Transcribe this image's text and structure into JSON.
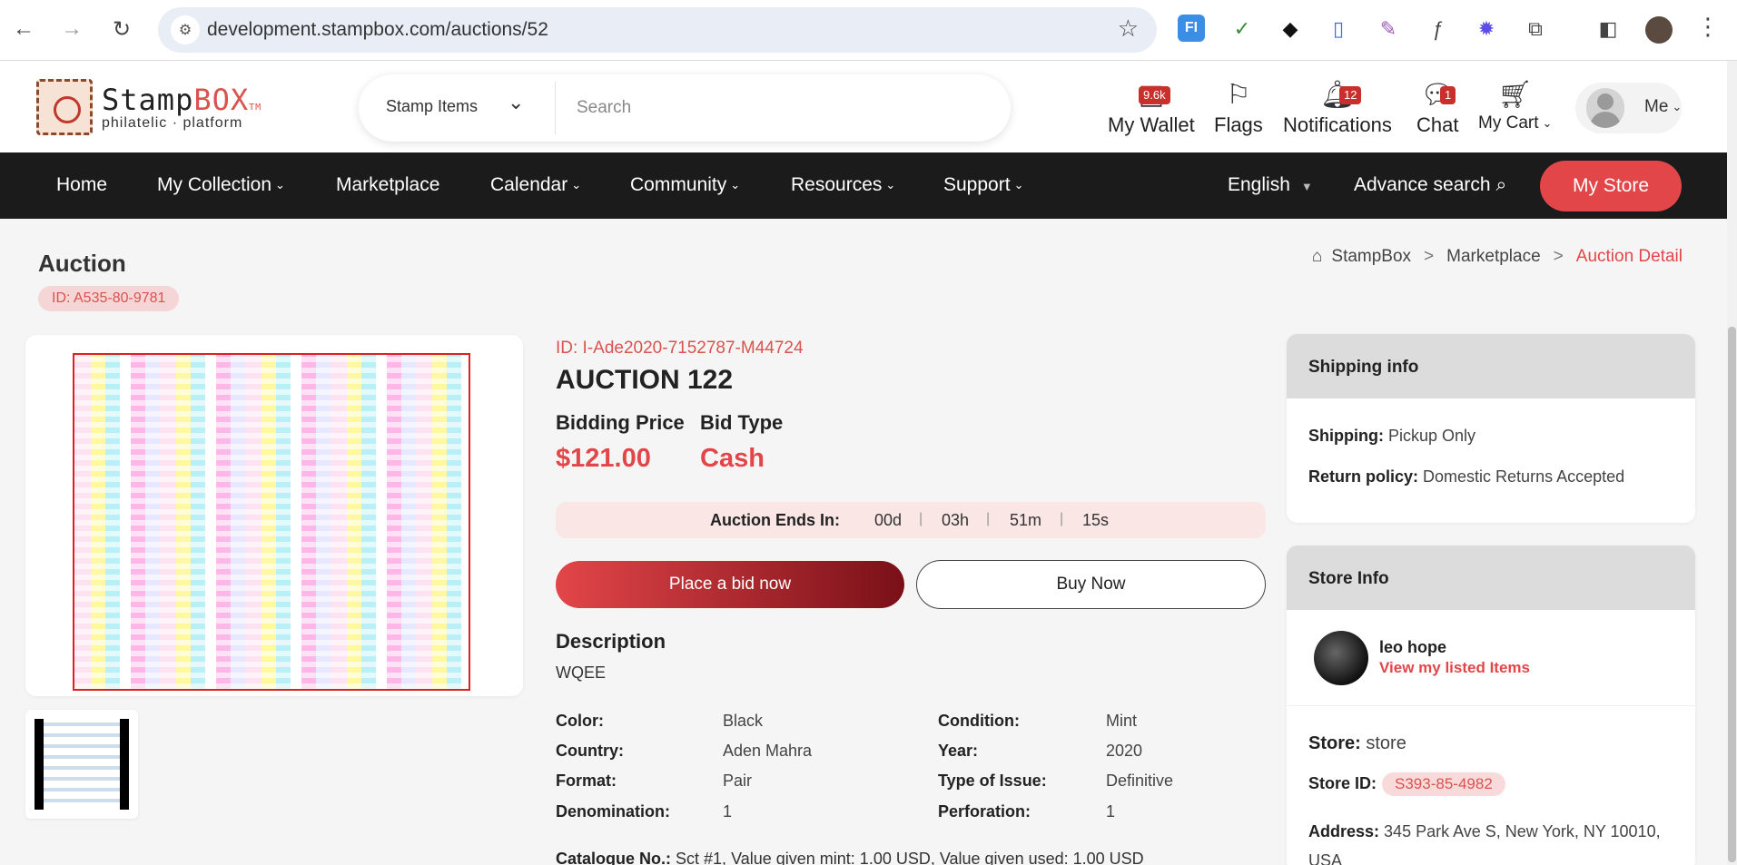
{
  "browser": {
    "url": "development.stampbox.com/auctions/52"
  },
  "logo": {
    "name_a": "Stamp",
    "name_b": "BOX",
    "tm": "TM",
    "tagline": "philatelic · platform"
  },
  "search": {
    "category": "Stamp Items",
    "placeholder": "Search"
  },
  "header": {
    "wallet_label": "My Wallet",
    "wallet_badge": "9.6k",
    "flags_label": "Flags",
    "notifications_label": "Notifications",
    "notifications_badge": "12",
    "chat_label": "Chat",
    "chat_badge": "1",
    "cart_label": "My Cart",
    "me_label": "Me"
  },
  "nav": {
    "home": "Home",
    "my_collection": "My Collection",
    "marketplace": "Marketplace",
    "calendar": "Calendar",
    "community": "Community",
    "resources": "Resources",
    "support": "Support",
    "language": "English",
    "advance_search": "Advance search",
    "my_store": "My Store"
  },
  "page": {
    "title": "Auction",
    "auction_id": "ID: A535-80-9781",
    "breadcrumb": {
      "home": "StampBox",
      "sep": ">",
      "middle": "Marketplace",
      "current": "Auction Detail"
    }
  },
  "item": {
    "id": "ID: I-Ade2020-7152787-M44724",
    "title": "AUCTION 122",
    "bidding_price_label": "Bidding Price",
    "bidding_price": "$121.00",
    "bid_type_label": "Bid Type",
    "bid_type": "Cash",
    "timer_label": "Auction Ends In:",
    "timer": {
      "days": "00d",
      "hours": "03h",
      "minutes": "51m",
      "seconds": "15s",
      "sep": "|"
    },
    "place_bid": "Place a bid now",
    "buy_now": "Buy Now",
    "description_heading": "Description",
    "description": "WQEE",
    "specs": {
      "color_label": "Color:",
      "color": "Black",
      "condition_label": "Condition:",
      "condition": "Mint",
      "country_label": "Country:",
      "country": "Aden Mahra",
      "year_label": "Year:",
      "year": "2020",
      "format_label": "Format:",
      "format": "Pair",
      "issue_label": "Type of Issue:",
      "issue": "Definitive",
      "denomination_label": "Denomination:",
      "denomination": "1",
      "perforation_label": "Perforation:",
      "perforation": "1"
    },
    "catalogue_label": "Catalogue No.:",
    "catalogue_value": "Sct #1, Value given mint: 1.00 USD, Value given used: 1.00 USD"
  },
  "shipping": {
    "heading": "Shipping info",
    "shipping_label": "Shipping:",
    "shipping_value": "Pickup Only",
    "return_label": "Return policy:",
    "return_value": "Domestic Returns Accepted"
  },
  "store": {
    "heading": "Store Info",
    "seller": "leo hope",
    "listed_link": "View my listed Items",
    "store_label": "Store:",
    "store_value": "store",
    "store_id_label": "Store ID:",
    "store_id": "S393-85-4982",
    "address_label": "Address:",
    "address_line1": "345 Park Ave S, New York, NY 10010,",
    "address_line2": "USA"
  }
}
